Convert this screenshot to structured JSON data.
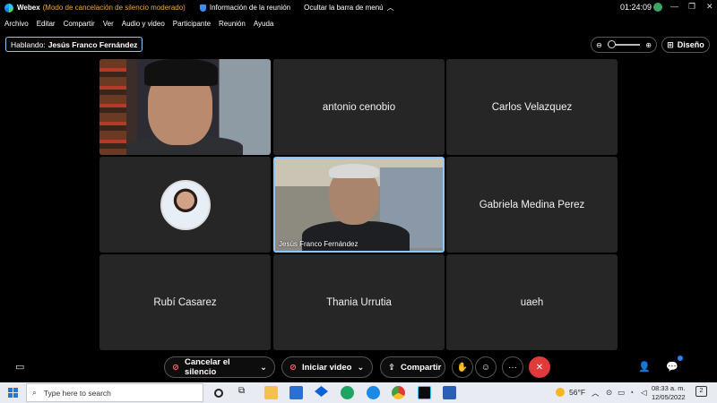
{
  "titlebar": {
    "app": "Webex",
    "mode": "(Modo de cancelación de silencio moderado)",
    "info": "Información de la reunión",
    "hide_menu": "Ocultar la barra de menú",
    "clock": "01:24:09",
    "status_initial": "J"
  },
  "menu": [
    "Archivo",
    "Editar",
    "Compartir",
    "Ver",
    "Audio y video",
    "Participante",
    "Reunión",
    "Ayuda"
  ],
  "speaking": {
    "label": "Hablando:",
    "name": "Jesús Franco Fernández"
  },
  "layout_button": "Diseño",
  "tiles": {
    "t2": "antonio cenobio",
    "t3": "Carlos Velazquez",
    "t5_caption": "Jesús Franco Fernández",
    "t6": "Gabriela Medina Perez",
    "t7": "Rubí Casarez",
    "t8": "Thania Urrutia",
    "t9": "uaeh"
  },
  "controls": {
    "mute": "Cancelar el silencio",
    "video": "Iniciar video",
    "share": "Compartir",
    "more": "···"
  },
  "taskbar": {
    "search_placeholder": "Type here to search",
    "temperature": "56°F",
    "time": "08:33 a. m.",
    "date": "12/05/2022"
  },
  "colors": {
    "accent": "#8cc8ff",
    "leave": "#e03a3a",
    "mode_text": "#f2a93b"
  }
}
